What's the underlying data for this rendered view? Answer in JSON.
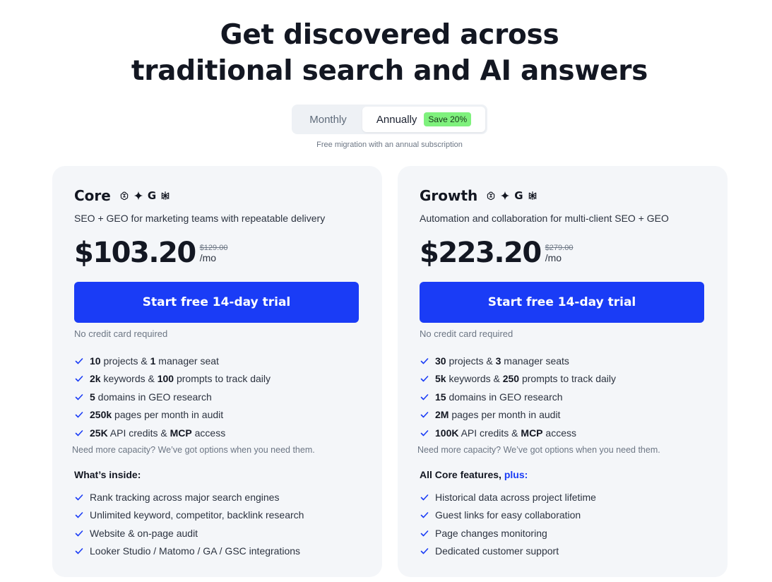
{
  "headline": {
    "line1": "Get discovered across",
    "line2": "traditional search and AI answers"
  },
  "billing_toggle": {
    "monthly_label": "Monthly",
    "annually_label": "Annually",
    "selected": "Annually",
    "save_badge": "Save 20%"
  },
  "migration_note": "Free migration with an annual subscription",
  "colors": {
    "accent_blue": "#1a3cf6",
    "badge_green": "#7ff17d",
    "card_bg": "#f4f6f9"
  },
  "engine_icons": [
    "openai-icon",
    "gemini-sparkle-icon",
    "google-icon",
    "perplexity-icon"
  ],
  "plans": [
    {
      "name": "Core",
      "description": "SEO + GEO for marketing teams with repeatable delivery",
      "price": "$103.20",
      "old_price": "$129.00",
      "period": "/mo",
      "cta_label": "Start free 14-day trial",
      "no_card_note": "No credit card required",
      "limits": [
        {
          "bold": "10",
          "text": " projects & ",
          "bold2": "1",
          "text2": " manager seat"
        },
        {
          "bold": "2k",
          "text": " keywords & ",
          "bold2": "100",
          "text2": " prompts to track daily"
        },
        {
          "bold": "5",
          "text": " domains in GEO research",
          "bold2": "",
          "text2": ""
        },
        {
          "bold": "250k",
          "text": " pages per month in audit",
          "bold2": "",
          "text2": ""
        },
        {
          "bold": "25K",
          "text": " API credits & ",
          "bold2": "MCP",
          "text2": " access"
        }
      ],
      "capacity_note": "Need more capacity? We’ve got options when you need them.",
      "inside_title": "What’s inside:",
      "inside_plus": "",
      "features": [
        "Rank tracking across major search engines",
        "Unlimited keyword, competitor, backlink research",
        "Website & on-page audit",
        "Looker Studio / Matomo / GA / GSC integrations"
      ]
    },
    {
      "name": "Growth",
      "description": "Automation and collaboration for multi-client SEO + GEO",
      "price": "$223.20",
      "old_price": "$279.00",
      "period": "/mo",
      "cta_label": "Start free 14-day trial",
      "no_card_note": "No credit card required",
      "limits": [
        {
          "bold": "30",
          "text": " projects & ",
          "bold2": "3",
          "text2": " manager seats"
        },
        {
          "bold": "5k",
          "text": " keywords & ",
          "bold2": "250",
          "text2": " prompts to track daily"
        },
        {
          "bold": "15",
          "text": " domains in GEO research",
          "bold2": "",
          "text2": ""
        },
        {
          "bold": "2M",
          "text": " pages per month in audit",
          "bold2": "",
          "text2": ""
        },
        {
          "bold": "100K",
          "text": " API credits & ",
          "bold2": "MCP",
          "text2": " access"
        }
      ],
      "capacity_note": "Need more capacity? We’ve got options when you need them.",
      "inside_title": "All Core features, ",
      "inside_plus": "plus:",
      "features": [
        "Historical data across project lifetime",
        "Guest links for easy collaboration",
        "Page changes monitoring",
        "Dedicated customer support"
      ]
    }
  ]
}
